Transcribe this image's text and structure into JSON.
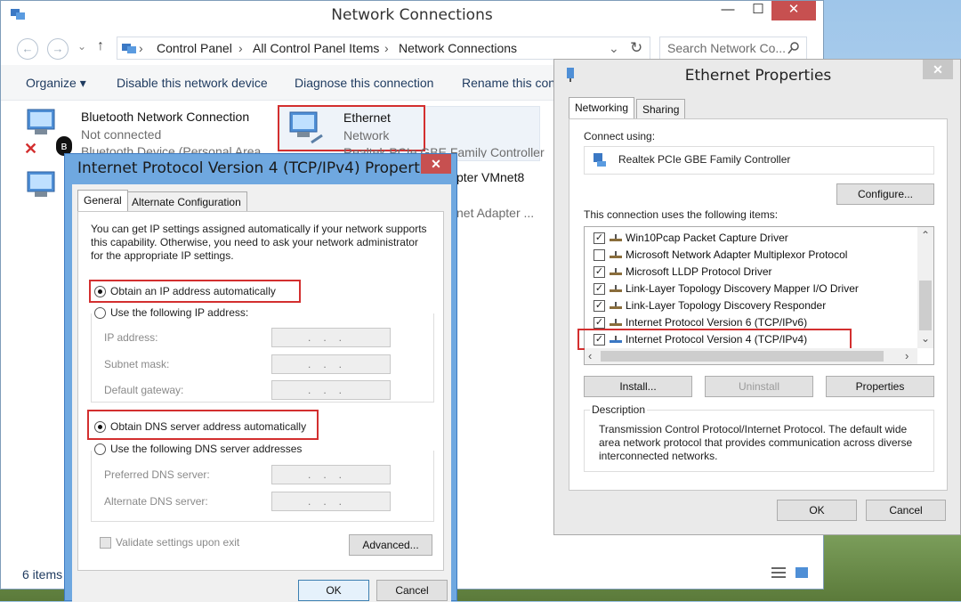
{
  "explorer": {
    "title": "Network Connections",
    "controls": {
      "minimize": "—",
      "maximize": "☐",
      "close": "✕"
    },
    "nav": {
      "back": "←",
      "forward": "→",
      "recent": "⌄",
      "up": "↑"
    },
    "breadcrumb": [
      "Control Panel",
      "All Control Panel Items",
      "Network Connections"
    ],
    "refresh": "↻",
    "search_placeholder": "Search Network Co...",
    "commands": {
      "organize": "Organize ▾",
      "disable": "Disable this network device",
      "diagnose": "Diagnose this connection",
      "rename": "Rename this conn"
    },
    "connections": [
      {
        "name": "Bluetooth Network Connection",
        "status": "Not connected",
        "device": "Bluetooth Device (Personal Area"
      },
      {
        "name": "Ethernet",
        "status": "Network",
        "device": "Realtek PCIe GBE Family Controller"
      },
      {
        "name": "pter VMnet8",
        "status": "",
        "device": "net Adapter ..."
      }
    ],
    "status_count": "6 items"
  },
  "ipv4_dialog": {
    "title": "Internet Protocol Version 4 (TCP/IPv4) Properties",
    "close": "✕",
    "tabs": [
      "General",
      "Alternate Configuration"
    ],
    "intro": "You can get IP settings assigned automatically if your network supports this capability. Otherwise, you need to ask your network administrator for the appropriate IP settings.",
    "obtain_ip_auto": "Obtain an IP address automatically",
    "use_following_ip": "Use the following IP address:",
    "ip_address_label": "IP address:",
    "subnet_mask_label": "Subnet mask:",
    "default_gateway_label": "Default gateway:",
    "ip_placeholder": "...",
    "obtain_dns_auto": "Obtain DNS server address automatically",
    "use_following_dns": "Use the following DNS server addresses",
    "preferred_dns_label": "Preferred DNS server:",
    "alternate_dns_label": "Alternate DNS server:",
    "validate_label": "Validate settings upon exit",
    "advanced_button": "Advanced...",
    "ok_button": "OK",
    "cancel_button": "Cancel"
  },
  "eth_dialog": {
    "title": "Ethernet Properties",
    "close": "✕",
    "tabs": [
      "Networking",
      "Sharing"
    ],
    "connect_using_label": "Connect using:",
    "adapter_name": "Realtek PCIe GBE Family Controller",
    "configure_button": "Configure...",
    "items_label": "This connection uses the following items:",
    "items": [
      {
        "label": "Win10Pcap Packet Capture Driver",
        "checked": true
      },
      {
        "label": "Microsoft Network Adapter Multiplexor Protocol",
        "checked": false
      },
      {
        "label": "Microsoft LLDP Protocol Driver",
        "checked": true
      },
      {
        "label": "Link-Layer Topology Discovery Mapper I/O Driver",
        "checked": true
      },
      {
        "label": "Link-Layer Topology Discovery Responder",
        "checked": true
      },
      {
        "label": "Internet Protocol Version 6 (TCP/IPv6)",
        "checked": true
      },
      {
        "label": "Internet Protocol Version 4 (TCP/IPv4)",
        "checked": true
      }
    ],
    "install_button": "Install...",
    "uninstall_button": "Uninstall",
    "properties_button": "Properties",
    "description_label": "Description",
    "description_text": "Transmission Control Protocol/Internet Protocol. The default wide area network protocol that provides communication across diverse interconnected networks.",
    "ok_button": "OK",
    "cancel_button": "Cancel"
  }
}
